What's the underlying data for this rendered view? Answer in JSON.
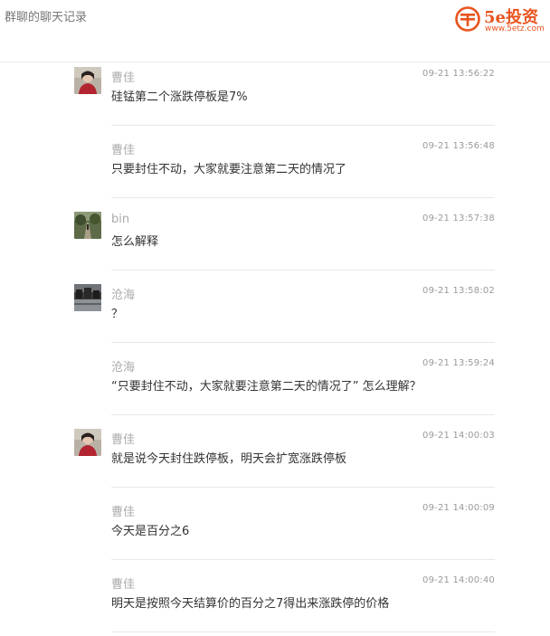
{
  "header": {
    "title": "群聊的聊天记录",
    "logo_name": "5e投资",
    "logo_url": "www.5etz.com",
    "brand_color": "#e8541e"
  },
  "messages": [
    {
      "sender": "曹佳",
      "time": "09-21 13:56:22",
      "text": "硅锰第二个涨跌停板是7%",
      "avatar": "avatar-caojia"
    },
    {
      "sender": "曹佳",
      "time": "09-21 13:56:48",
      "text": "只要封住不动，大家就要注意第二天的情况了",
      "avatar": ""
    },
    {
      "sender": "bin",
      "time": "09-21 13:57:38",
      "text": "怎么解释",
      "avatar": "avatar-bin"
    },
    {
      "sender": "沧海",
      "time": "09-21 13:58:02",
      "text": "？",
      "avatar": "avatar-canghai"
    },
    {
      "sender": "沧海",
      "time": "09-21 13:59:24",
      "text": "“只要封住不动，大家就要注意第二天的情况了” 怎么理解？",
      "avatar": ""
    },
    {
      "sender": "曹佳",
      "time": "09-21 14:00:03",
      "text": "就是说今天封住跌停板，明天会扩宽涨跌停板",
      "avatar": "avatar-caojia"
    },
    {
      "sender": "曹佳",
      "time": "09-21 14:00:09",
      "text": "今天是百分之6",
      "avatar": ""
    },
    {
      "sender": "曹佳",
      "time": "09-21 14:00:40",
      "text": "明天是按照今天结算价的百分之7得出来涨跌停的价格",
      "avatar": ""
    }
  ]
}
